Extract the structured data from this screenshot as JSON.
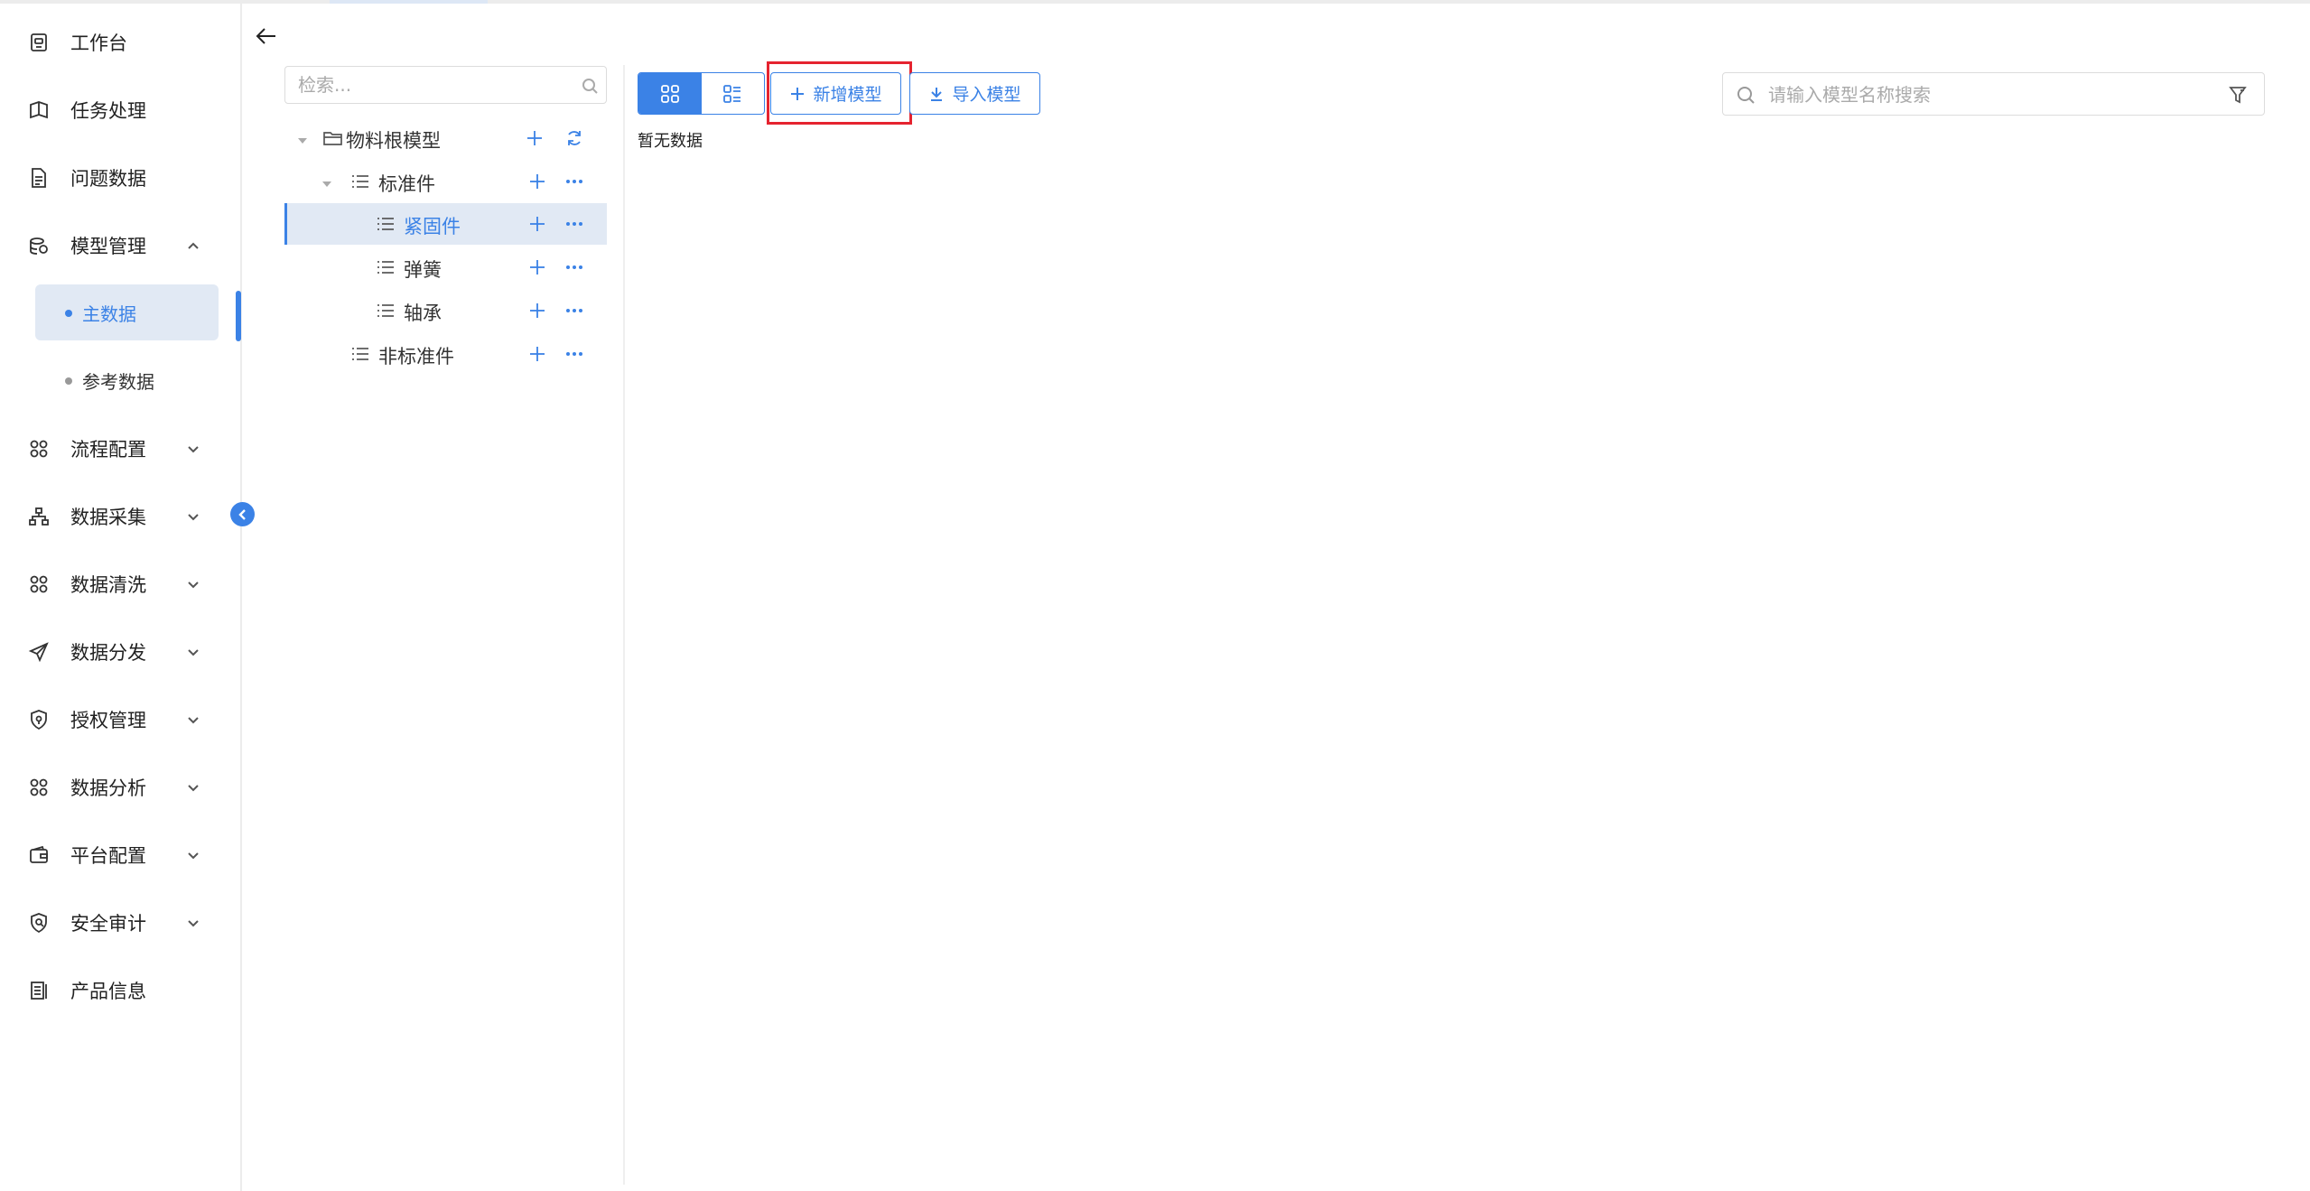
{
  "sidebar": {
    "items": [
      {
        "label": "工作台",
        "icon": "workbench-icon"
      },
      {
        "label": "任务处理",
        "icon": "task-icon"
      },
      {
        "label": "问题数据",
        "icon": "document-icon"
      },
      {
        "label": "模型管理",
        "icon": "database-icon",
        "expanded": true,
        "children": [
          {
            "label": "主数据",
            "active": true
          },
          {
            "label": "参考数据",
            "active": false
          }
        ]
      },
      {
        "label": "流程配置",
        "icon": "apps-icon"
      },
      {
        "label": "数据采集",
        "icon": "org-chart-icon"
      },
      {
        "label": "数据清洗",
        "icon": "apps-icon"
      },
      {
        "label": "数据分发",
        "icon": "send-icon"
      },
      {
        "label": "授权管理",
        "icon": "shield-icon"
      },
      {
        "label": "数据分析",
        "icon": "apps-icon"
      },
      {
        "label": "平台配置",
        "icon": "wallet-icon"
      },
      {
        "label": "安全审计",
        "icon": "audit-icon"
      },
      {
        "label": "产品信息",
        "icon": "info-doc-icon"
      }
    ]
  },
  "tree": {
    "search_placeholder": "检索...",
    "nodes": [
      {
        "label": "物料根模型",
        "level": 0,
        "expanded": true,
        "icon": "folder-icon"
      },
      {
        "label": "标准件",
        "level": 1,
        "expanded": true,
        "icon": "list-icon"
      },
      {
        "label": "紧固件",
        "level": 2,
        "selected": true,
        "icon": "list-icon"
      },
      {
        "label": "弹簧",
        "level": 2,
        "icon": "list-icon"
      },
      {
        "label": "轴承",
        "level": 2,
        "icon": "list-icon"
      },
      {
        "label": "非标准件",
        "level": 1,
        "icon": "list-icon"
      }
    ]
  },
  "toolbar": {
    "add_model_label": "新增模型",
    "import_model_label": "导入模型",
    "highlight_color": "#e5232f"
  },
  "main": {
    "empty_text": "暂无数据",
    "search_placeholder": "请输入模型名称搜索"
  },
  "colors": {
    "accent": "#3b82e6",
    "selected_bg": "#e1e9f4"
  }
}
